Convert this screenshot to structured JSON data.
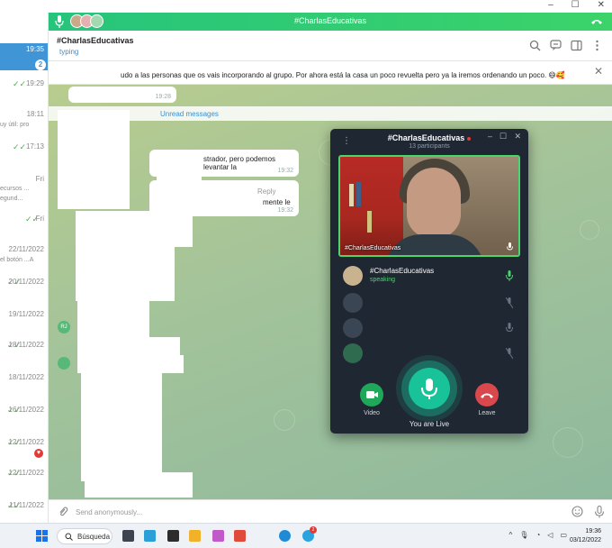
{
  "window": {
    "controls": [
      "–",
      "☐",
      "✕"
    ]
  },
  "call_banner": {
    "title": "#CharlasEducativas"
  },
  "chat": {
    "name": "#CharlasEducativas",
    "status": "typing",
    "pinned_text": "udo a las personas que os vais incorporando al grupo. Por ahora está la casa un poco revuelta pero ya la iremos ordenando un poco. 😄🥰",
    "unread_label": "Unread messages",
    "input_placeholder": "Send anonymously...",
    "messages": [
      {
        "text": "strador, pero podemos levantar la",
        "time": "19:32"
      },
      {
        "text": "mente le",
        "reply": "Reply",
        "time": "19:32"
      }
    ],
    "pinned_time": "19:28"
  },
  "chat_list": {
    "items": [
      {
        "time": "19:35",
        "badge": "2"
      },
      {
        "time": "19:29"
      },
      {
        "time": "18:11",
        "sub": "uy útil: pro"
      },
      {
        "time": "17:13"
      },
      {
        "time": "Fri",
        "sub": "ecursos ...",
        "sub2": "egund..."
      },
      {
        "time": "Fri"
      },
      {
        "time": "22/11/2022",
        "sub": "el botón ...A"
      },
      {
        "time": "20/11/2022"
      },
      {
        "time": "19/11/2022"
      },
      {
        "time": "18/11/2022"
      },
      {
        "time": "18/11/2022"
      },
      {
        "time": "16/11/2022"
      },
      {
        "time": "12/11/2022"
      },
      {
        "time": "12/11/2022"
      },
      {
        "time": "11/11/2022"
      }
    ],
    "avatar_initials": "RJ"
  },
  "voice_chat": {
    "title": "#CharlasEducativas",
    "participants_count": "13 participants",
    "video_label": "#CharlasEducativas",
    "participants": [
      {
        "name": "#CharlasEducativas",
        "status": "speaking"
      }
    ],
    "video_button": "Video",
    "leave_button": "Leave",
    "live_status": "You are Live"
  },
  "taskbar": {
    "search_label": "Búsqueda",
    "time": "19:36",
    "date": "03/12/2022",
    "telegram_badge": "2"
  },
  "colors": {
    "accent_blue": "#3f95d6",
    "call_green": "#2ecc71",
    "leave_red": "#d9484d",
    "live_teal": "#19c39a"
  }
}
